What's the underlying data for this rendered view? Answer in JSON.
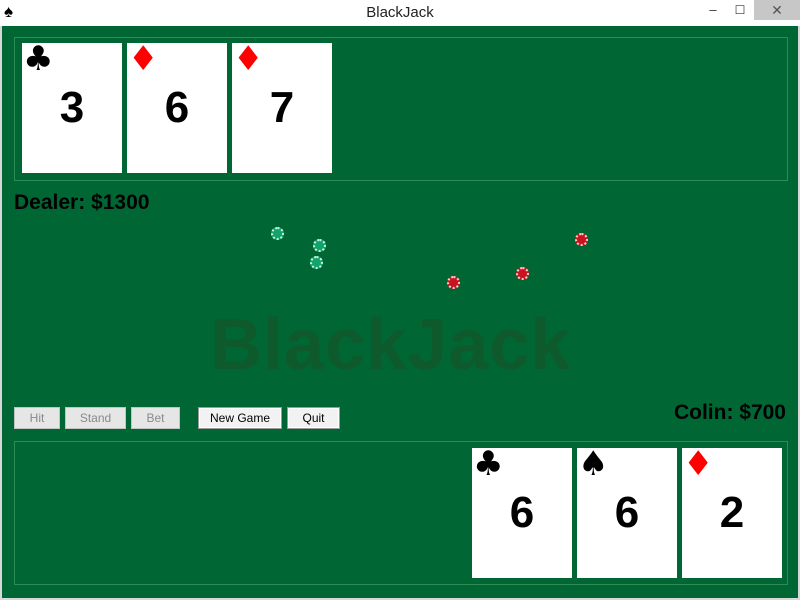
{
  "window": {
    "title": "BlackJack",
    "app_icon": "spade-icon",
    "app_icon_glyph": "♠",
    "minimize_glyph": "–",
    "maximize_glyph": "☐",
    "close_glyph": "✕"
  },
  "table": {
    "felt_color": "#006633",
    "watermark": "BlackJack"
  },
  "dealer": {
    "label": "Dealer: $1300",
    "cards": [
      {
        "rank": "3",
        "suit": "clubs",
        "suit_glyph": "♣",
        "color": "black"
      },
      {
        "rank": "6",
        "suit": "diamonds",
        "suit_glyph": "♦",
        "color": "red"
      },
      {
        "rank": "7",
        "suit": "diamonds",
        "suit_glyph": "♦",
        "color": "red"
      }
    ]
  },
  "player": {
    "label": "Colin: $700",
    "cards": [
      {
        "rank": "6",
        "suit": "clubs",
        "suit_glyph": "♣",
        "color": "black"
      },
      {
        "rank": "6",
        "suit": "spades",
        "suit_glyph": "♠",
        "color": "black"
      },
      {
        "rank": "2",
        "suit": "diamonds",
        "suit_glyph": "♦",
        "color": "red"
      }
    ]
  },
  "chips": {
    "green_count": 3,
    "red_count": 3,
    "green_color": "#11a36a",
    "red_color": "#c8141e"
  },
  "controls": {
    "hit": {
      "label": "Hit",
      "enabled": false
    },
    "stand": {
      "label": "Stand",
      "enabled": false
    },
    "bet": {
      "label": "Bet",
      "enabled": false
    },
    "new_game": {
      "label": "New Game",
      "enabled": true
    },
    "quit": {
      "label": "Quit",
      "enabled": true
    }
  }
}
